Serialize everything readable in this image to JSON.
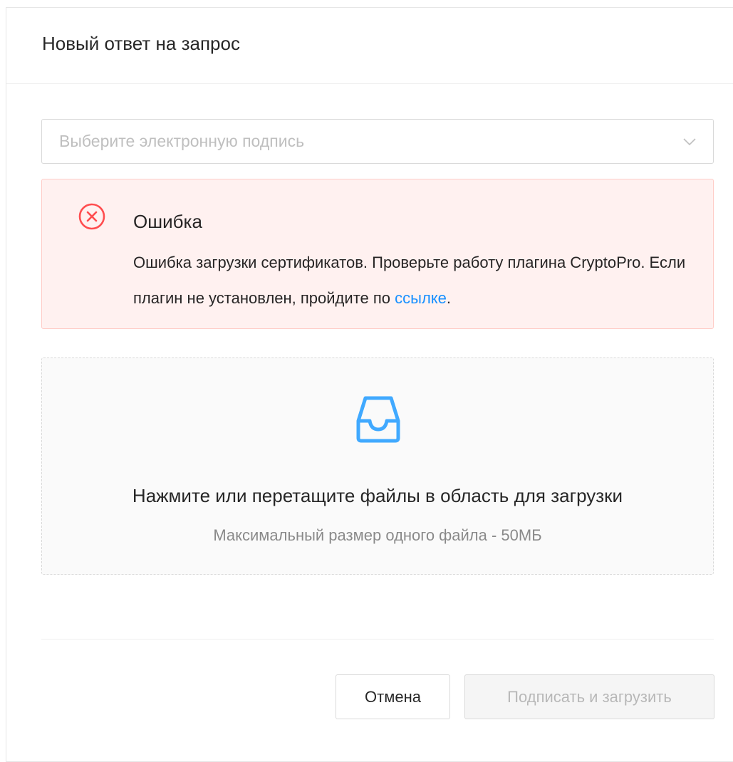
{
  "modal": {
    "title": "Новый ответ на запрос"
  },
  "signature_select": {
    "placeholder": "Выберите электронную подпись",
    "arrow_icon": "chevron-down-icon"
  },
  "alert": {
    "type": "error",
    "icon": "close-circle-icon",
    "title": "Ошибка",
    "description_text": "Ошибка загрузки сертификатов. Проверьте работу плагина CryptoPro. Если плагин не установлен, пройдите по ",
    "link_text": "ссылке",
    "description_end": "."
  },
  "upload": {
    "icon": "inbox-icon",
    "text": "Нажмите или перетащите файлы в область для загрузки",
    "hint": "Максимальный размер одного файла - 50МБ"
  },
  "footer": {
    "cancel_label": "Отмена",
    "submit_label": "Подписать и загрузить",
    "submit_disabled": true
  },
  "colors": {
    "error": "#ff4d4f",
    "error_bg": "#fff1f0",
    "error_border": "#ffccc7",
    "link": "#1890ff",
    "upload_icon": "#40a9ff"
  }
}
